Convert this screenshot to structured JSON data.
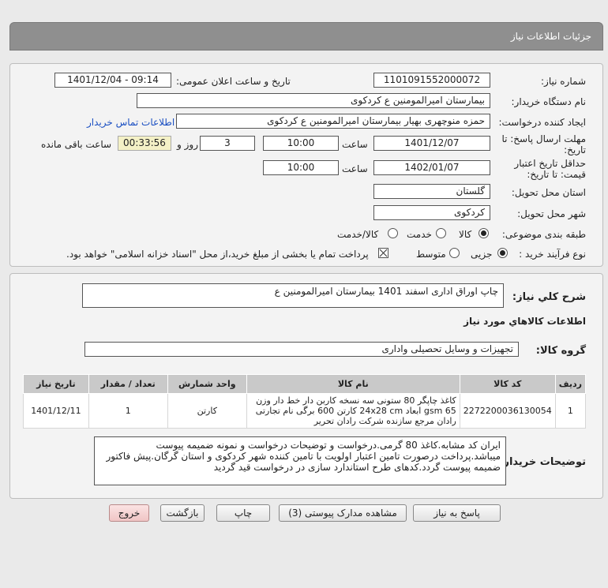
{
  "panel_title": "جزئیات اطلاعات نیاز",
  "fields": {
    "need_number_label": "شماره نیاز:",
    "need_number": "1101091552000072",
    "announce_label": "تاریخ و ساعت اعلان عمومی:",
    "announce_value": "1401/12/04 - 09:14",
    "buyer_org_label": "نام دستگاه خریدار:",
    "buyer_org": "بیمارستان امیرالمومنین  ع  کردکوی",
    "creator_label": "ایجاد کننده درخواست:",
    "creator": "حمزه  منوچهری بهیار بیمارستان امیرالمومنین  ع  کردکوی",
    "contact_link": "اطلاعات تماس خریدار",
    "deadline_label": "مهلت ارسال پاسخ: تا",
    "deadline_label2": "تاریخ:",
    "deadline_date": "1401/12/07",
    "time_label": "ساعت",
    "deadline_time": "10:00",
    "days_value": "3",
    "days_label": "روز و",
    "remaining_time": "00:33:56",
    "remaining_label": "ساعت باقی مانده",
    "validity_label": "حداقل تاریخ اعتبار",
    "validity_label2": "قیمت: تا تاریخ:",
    "validity_date": "1402/01/07",
    "validity_time": "10:00",
    "province_label": "استان محل تحویل:",
    "province": "گلستان",
    "city_label": "شهر محل تحویل:",
    "city": "کردکوی",
    "category_label": "طبقه بندی موضوعی:",
    "category_opt1": "کالا",
    "category_opt2": "خدمت",
    "category_opt3": "کالا/خدمت",
    "process_label": "نوع فرآیند خرید :",
    "process_opt1": "جزیی",
    "process_opt2": "متوسط",
    "payment_note": "پرداخت تمام یا بخشی از مبلغ خرید،از محل \"اسناد خزانه اسلامی\" خواهد بود."
  },
  "summary": {
    "label": "شرح کلي نياز:",
    "value": "چاپ اوراق اداری اسفند 1401 بیمارستان امیرالمومنین ع"
  },
  "goods_section": {
    "title": "اطلاعات کالاهاي مورد نياز",
    "group_label": "گروه کالا:",
    "group_value": "تجهیزات و وسایل تحصیلی واداری"
  },
  "table": {
    "headers": [
      "ردیف",
      "کد کالا",
      "نام کالا",
      "واحد شمارش",
      "تعداد / مقدار",
      "تاریخ نیاز"
    ],
    "rows": [
      {
        "row": "1",
        "code": "2272200036130054",
        "name": "کاغذ چاپگر 80 ستونی سه نسخه کاربن دار خط دار وزن 65 gsm ابعاد 24x28 cm کارتن 600 برگی نام تجارتی رادان مرجع سازنده شرکت رادان تحریر",
        "unit": "کارتن",
        "qty": "1",
        "date": "1401/12/11"
      }
    ]
  },
  "buyer_notes": {
    "label": "توضیحات خریدار:",
    "text": "ایران کد مشابه.کاغذ 80 گرمی.درخواست و توضیحات درخواست و نمونه ضمیمه پیوست میباشد.پرداخت درصورت تامین اعتبار اولویت با تامین کننده شهر کردکوی و استان گرگان.پیش فاکتور ضمیمه پیوست گردد.کدهای طرح استاندارد سازی در درخواست قید گردید"
  },
  "buttons": {
    "reply": "پاسخ به نیاز",
    "attachments": "مشاهده مدارک پیوستی (3)",
    "print": "چاپ",
    "back": "بازگشت",
    "exit": "خروج"
  },
  "colors": {
    "title_bar": "#8f8f8f",
    "link": "#1a4fc2",
    "remaining_bg": "#f4f1c6",
    "exit_button": "#f0c5c5"
  }
}
